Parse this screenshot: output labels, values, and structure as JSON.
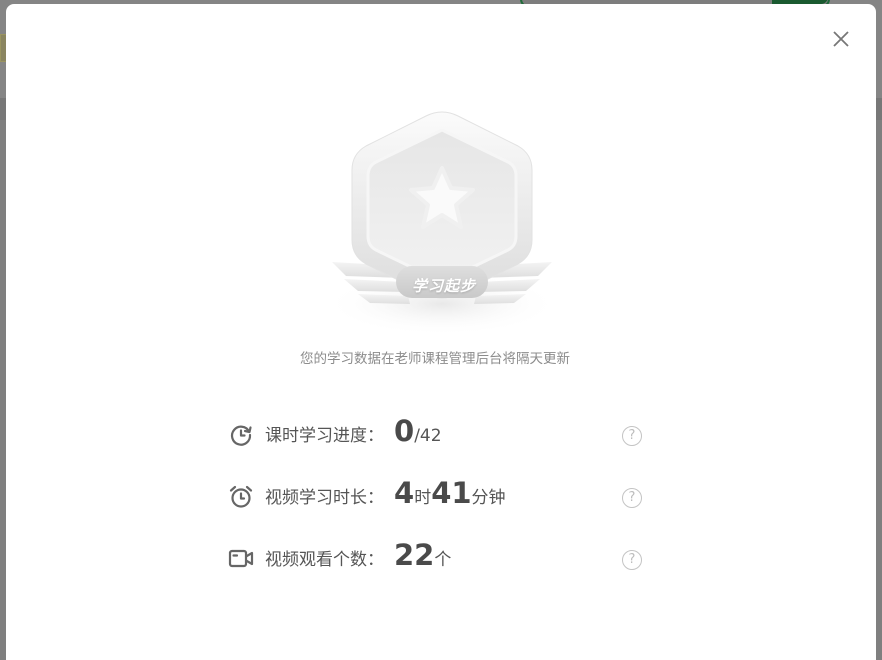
{
  "modal": {
    "badge_title": "学习起步",
    "note": "您的学习数据在老师课程管理后台将隔天更新",
    "close_icon": "close-icon"
  },
  "stats": {
    "progress": {
      "icon": "progress-icon",
      "label": "课时学习进度：",
      "value": "0",
      "total": "/42"
    },
    "duration": {
      "icon": "alarm-clock-icon",
      "label": "视频学习时长：",
      "hours": "4",
      "hours_unit": "时",
      "minutes": "41",
      "minutes_unit": "分钟"
    },
    "count": {
      "icon": "video-camera-icon",
      "label": "视频观看个数：",
      "value": "22",
      "unit": "个"
    },
    "help_glyph": "?"
  },
  "colors": {
    "modal_bg": "#ffffff",
    "overlay": "#7f7f7f",
    "text": "#555555",
    "note": "#8c8c8c",
    "help": "#c4c4c4"
  }
}
